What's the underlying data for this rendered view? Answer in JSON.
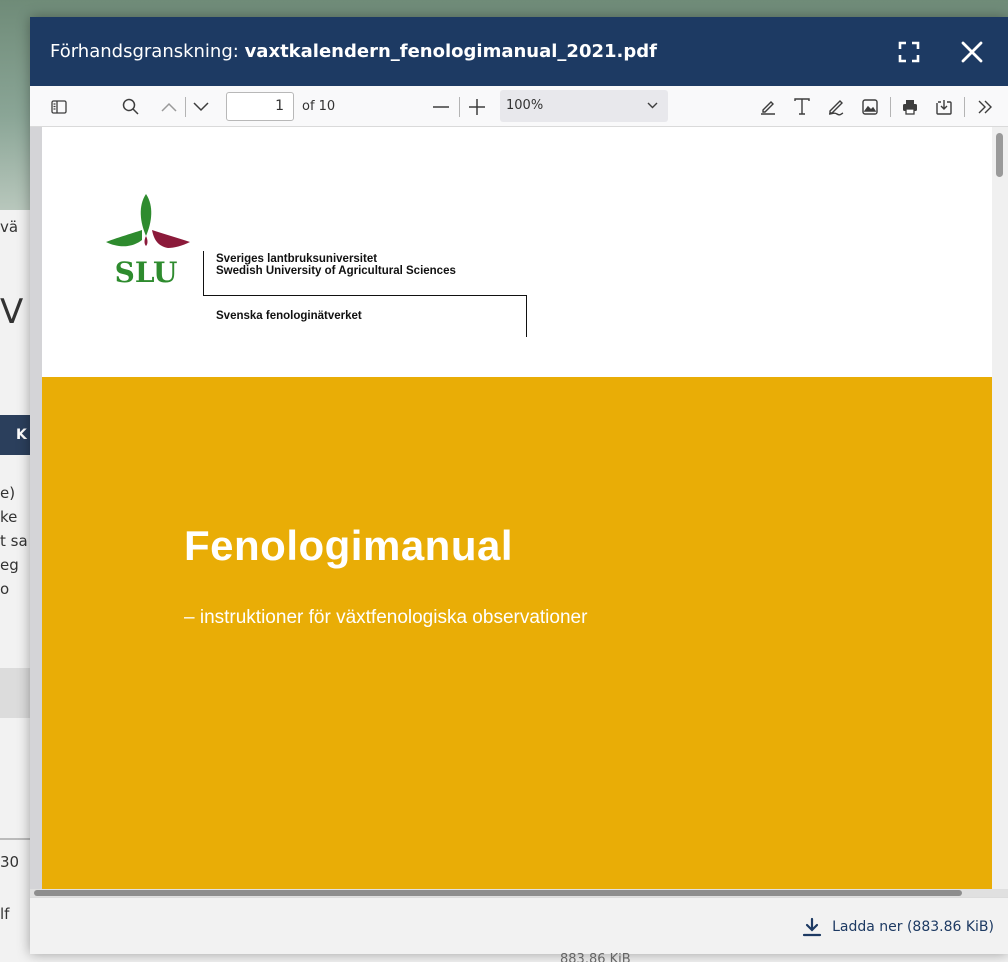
{
  "background": {
    "nav_fragment": "vä",
    "heading_fragment": "V",
    "button_fragment": "K",
    "text_fragments": [
      "e)",
      "ke",
      "t sa",
      "eg",
      " o"
    ],
    "number_fragment": "30",
    "row_fragment": "lf",
    "size_fragment": "883.86 KiB"
  },
  "modal": {
    "title_prefix": "Förhandsgranskning:",
    "filename": "vaxtkalendern_fenologimanual_2021.pdf",
    "expand_icon": "expand-icon",
    "close_icon": "close-icon"
  },
  "toolbar": {
    "current_page": "1",
    "page_count_label": "of 10",
    "zoom_value": "100%",
    "icons": [
      "sidebar-toggle-icon",
      "search-icon",
      "chevron-up-icon",
      "chevron-down-icon",
      "zoom-out-icon",
      "zoom-in-icon",
      "highlight-icon",
      "text-icon",
      "draw-icon",
      "image-icon",
      "print-icon",
      "save-icon",
      "more-tools-icon"
    ]
  },
  "document": {
    "logo_text": "SLU",
    "affiliation_sv": "Sveriges lantbruksuniversitet",
    "affiliation_en": "Swedish University of Agricultural Sciences",
    "network": "Svenska fenologinätverket",
    "title": "Fenologimanual",
    "subtitle": "– instruktioner för växtfenologiska observationer",
    "band_color": "#E9AD06",
    "logo_green": "#2E8B2E",
    "logo_red": "#8B1A3A"
  },
  "footer": {
    "download_label": "Ladda ner (883.86 KiB)",
    "download_icon": "download-icon"
  },
  "colors": {
    "header_bg": "#1D3A63",
    "link": "#1D3A63"
  }
}
